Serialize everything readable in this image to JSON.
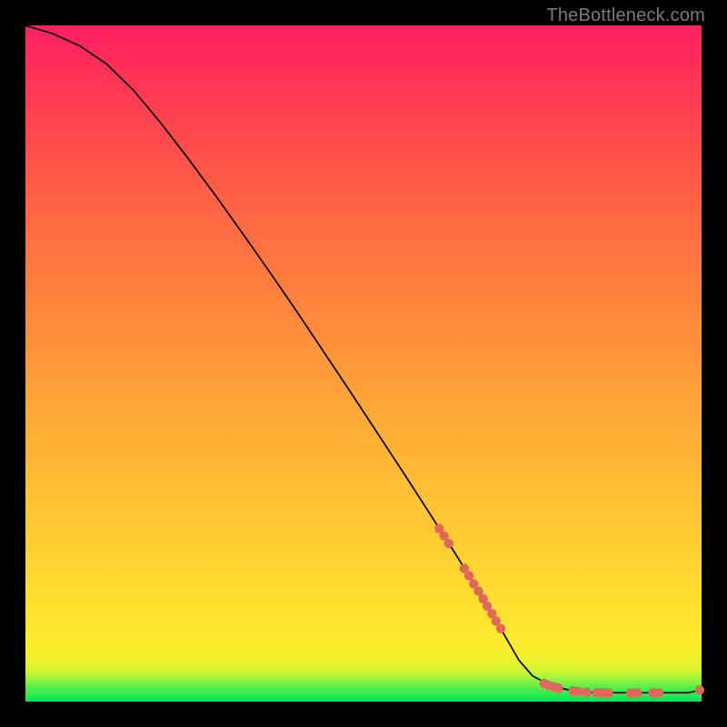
{
  "watermark": "TheBottleneck.com",
  "chart_data": {
    "type": "line",
    "title": "",
    "xlabel": "",
    "ylabel": "",
    "xlim": [
      0,
      100
    ],
    "ylim": [
      0,
      100
    ],
    "grid": false,
    "legend": false,
    "series": [
      {
        "name": "curve",
        "style": "line",
        "color": "#000000",
        "x": [
          0,
          4,
          8,
          12,
          16,
          20,
          24,
          28,
          32,
          36,
          40,
          44,
          48,
          52,
          56,
          60,
          63,
          66,
          68,
          70,
          71.5,
          73,
          75,
          78,
          82,
          86,
          90,
          94,
          98,
          100
        ],
        "y": [
          100,
          98.8,
          97.0,
          94.3,
          90.4,
          85.6,
          80.4,
          75.0,
          69.4,
          63.7,
          57.9,
          51.9,
          45.9,
          39.8,
          33.7,
          27.5,
          22.8,
          18.0,
          14.7,
          11.3,
          8.7,
          6.1,
          3.8,
          2.2,
          1.4,
          1.3,
          1.3,
          1.3,
          1.3,
          1.7
        ]
      },
      {
        "name": "markers",
        "style": "scatter",
        "color": "#e0675b",
        "x": [
          61.2,
          61.9,
          62.6,
          64.9,
          65.6,
          66.3,
          67.0,
          67.7,
          68.3,
          69.0,
          69.6,
          70.3,
          76.7,
          77.4,
          78.1,
          78.8,
          81.0,
          81.8,
          83.0,
          84.5,
          85.3,
          86.2,
          89.5,
          90.5,
          92.8,
          93.7,
          99.7
        ],
        "y": [
          25.6,
          24.5,
          23.4,
          19.7,
          18.6,
          17.4,
          16.3,
          15.2,
          14.1,
          13.0,
          11.9,
          10.8,
          2.7,
          2.4,
          2.2,
          2.0,
          1.6,
          1.5,
          1.4,
          1.35,
          1.32,
          1.3,
          1.3,
          1.3,
          1.3,
          1.3,
          1.7
        ]
      }
    ]
  }
}
